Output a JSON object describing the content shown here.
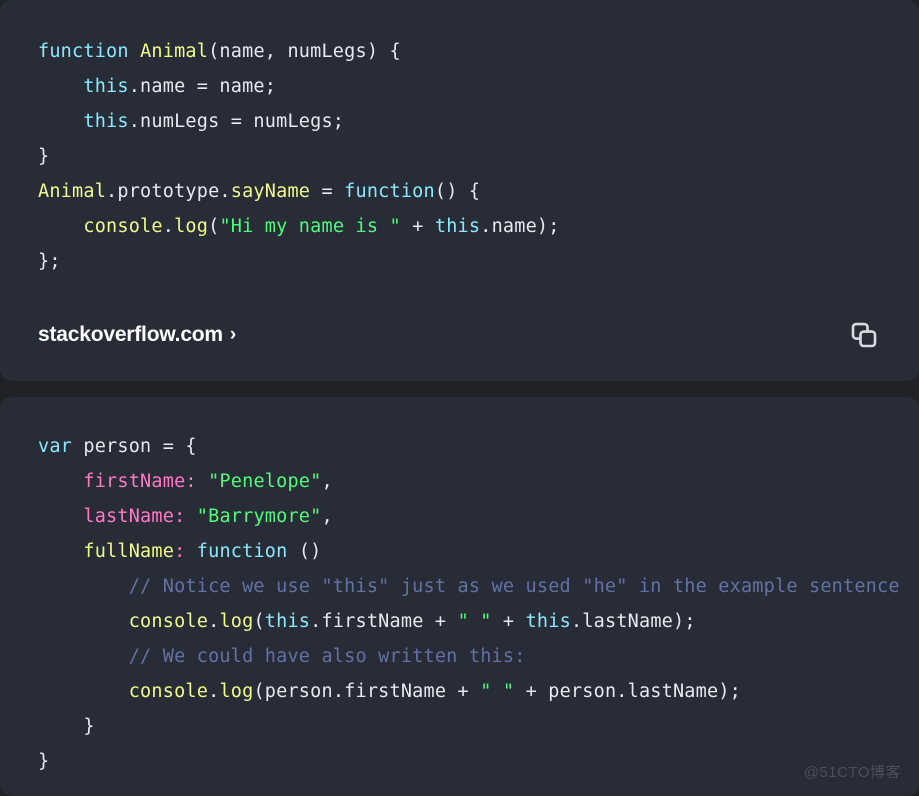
{
  "theme": {
    "page_background": "#212228",
    "card_background": "#282c37",
    "text": "#e6e9ef",
    "keyword": "#8be9fd",
    "function_name": "#f1fa8c",
    "string": "#50fa7b",
    "property": "#ff79c6",
    "comment": "#6272a4",
    "link": "#ffffff",
    "watermark": "#4b4e5b"
  },
  "cards": [
    {
      "name": "animal-prototype-snippet",
      "language": "javascript",
      "lines": [
        [
          {
            "t": "function",
            "c": "kw"
          },
          {
            "t": " ",
            "c": "plain"
          },
          {
            "t": "Animal",
            "c": "fnname"
          },
          {
            "t": "(name, numLegs) {",
            "c": "plain"
          }
        ],
        [
          {
            "t": "    ",
            "c": "plain"
          },
          {
            "t": "this",
            "c": "kw"
          },
          {
            "t": ".name = name;",
            "c": "plain"
          }
        ],
        [
          {
            "t": "    ",
            "c": "plain"
          },
          {
            "t": "this",
            "c": "kw"
          },
          {
            "t": ".numLegs = numLegs;",
            "c": "plain"
          }
        ],
        [
          {
            "t": "}",
            "c": "plain"
          }
        ],
        [
          {
            "t": "Animal",
            "c": "fnname"
          },
          {
            "t": ".prototype.",
            "c": "plain"
          },
          {
            "t": "sayName",
            "c": "fnname"
          },
          {
            "t": " = ",
            "c": "plain"
          },
          {
            "t": "function",
            "c": "kw"
          },
          {
            "t": "() {",
            "c": "plain"
          }
        ],
        [
          {
            "t": "    ",
            "c": "plain"
          },
          {
            "t": "console",
            "c": "fnname"
          },
          {
            "t": ".",
            "c": "plain"
          },
          {
            "t": "log",
            "c": "fnname"
          },
          {
            "t": "(",
            "c": "plain"
          },
          {
            "t": "\"Hi my name is \"",
            "c": "str"
          },
          {
            "t": " + ",
            "c": "plain"
          },
          {
            "t": "this",
            "c": "kw"
          },
          {
            "t": ".name);",
            "c": "plain"
          }
        ],
        [
          {
            "t": "};",
            "c": "plain"
          }
        ]
      ],
      "footer": {
        "source_label": "stackoverflow.com",
        "chevron": "›",
        "copy_icon": "copy-icon"
      }
    },
    {
      "name": "person-object-snippet",
      "language": "javascript",
      "lines": [
        [
          {
            "t": "var",
            "c": "kw"
          },
          {
            "t": " person = {",
            "c": "plain"
          }
        ],
        [
          {
            "t": "    ",
            "c": "plain"
          },
          {
            "t": "firstName",
            "c": "prop"
          },
          {
            "t": ":",
            "c": "prop"
          },
          {
            "t": " ",
            "c": "plain"
          },
          {
            "t": "\"Penelope\"",
            "c": "str"
          },
          {
            "t": ",",
            "c": "plain"
          }
        ],
        [
          {
            "t": "    ",
            "c": "plain"
          },
          {
            "t": "lastName",
            "c": "prop"
          },
          {
            "t": ":",
            "c": "prop"
          },
          {
            "t": " ",
            "c": "plain"
          },
          {
            "t": "\"Barrymore\"",
            "c": "str"
          },
          {
            "t": ",",
            "c": "plain"
          }
        ],
        [
          {
            "t": "    ",
            "c": "plain"
          },
          {
            "t": "fullName",
            "c": "fnname"
          },
          {
            "t": ":",
            "c": "prop"
          },
          {
            "t": " ",
            "c": "plain"
          },
          {
            "t": "function",
            "c": "kw"
          },
          {
            "t": " ()",
            "c": "plain"
          }
        ],
        [
          {
            "t": "        ",
            "c": "plain"
          },
          {
            "t": "// Notice we use \"this\" just as we used \"he\" in the example sentence",
            "c": "cmt"
          }
        ],
        [
          {
            "t": "        ",
            "c": "plain"
          },
          {
            "t": "console",
            "c": "fnname"
          },
          {
            "t": ".",
            "c": "plain"
          },
          {
            "t": "log",
            "c": "fnname"
          },
          {
            "t": "(",
            "c": "plain"
          },
          {
            "t": "this",
            "c": "kw"
          },
          {
            "t": ".firstName + ",
            "c": "plain"
          },
          {
            "t": "\" \"",
            "c": "str"
          },
          {
            "t": " + ",
            "c": "plain"
          },
          {
            "t": "this",
            "c": "kw"
          },
          {
            "t": ".lastName);",
            "c": "plain"
          }
        ],
        [
          {
            "t": "        ",
            "c": "plain"
          },
          {
            "t": "// We could have also written this:",
            "c": "cmt"
          }
        ],
        [
          {
            "t": "        ",
            "c": "plain"
          },
          {
            "t": "console",
            "c": "fnname"
          },
          {
            "t": ".",
            "c": "plain"
          },
          {
            "t": "log",
            "c": "fnname"
          },
          {
            "t": "(person.firstName + ",
            "c": "plain"
          },
          {
            "t": "\" \"",
            "c": "str"
          },
          {
            "t": " + person.lastName);",
            "c": "plain"
          }
        ],
        [
          {
            "t": "    }",
            "c": "plain"
          }
        ],
        [
          {
            "t": "}",
            "c": "plain"
          }
        ]
      ]
    }
  ],
  "watermark": "@51CTO博客"
}
